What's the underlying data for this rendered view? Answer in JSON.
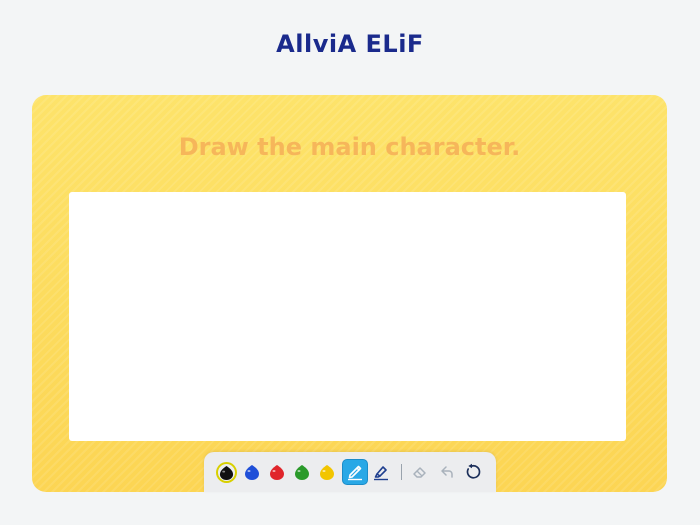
{
  "app": {
    "title": "AllviA ELiF"
  },
  "task": {
    "prompt": "Draw the main character."
  },
  "toolbar": {
    "colors": [
      {
        "name": "black",
        "hex": "#111111",
        "selected": true
      },
      {
        "name": "blue",
        "hex": "#1f4fd8",
        "selected": false
      },
      {
        "name": "red",
        "hex": "#e0252b",
        "selected": false
      },
      {
        "name": "green",
        "hex": "#2a9a2a",
        "selected": false
      },
      {
        "name": "yellow",
        "hex": "#f2c500",
        "selected": false
      }
    ],
    "tools": [
      {
        "name": "pen-icon",
        "active": true
      },
      {
        "name": "highlighter-icon",
        "active": false
      },
      {
        "name": "eraser-icon",
        "active": false
      },
      {
        "name": "undo-icon",
        "active": false
      },
      {
        "name": "reset-icon",
        "active": false
      }
    ]
  },
  "colors": {
    "title": "#1a2a8c",
    "prompt": "#f6b65a",
    "card": "#fcd553",
    "accent": "#29a8e6"
  }
}
